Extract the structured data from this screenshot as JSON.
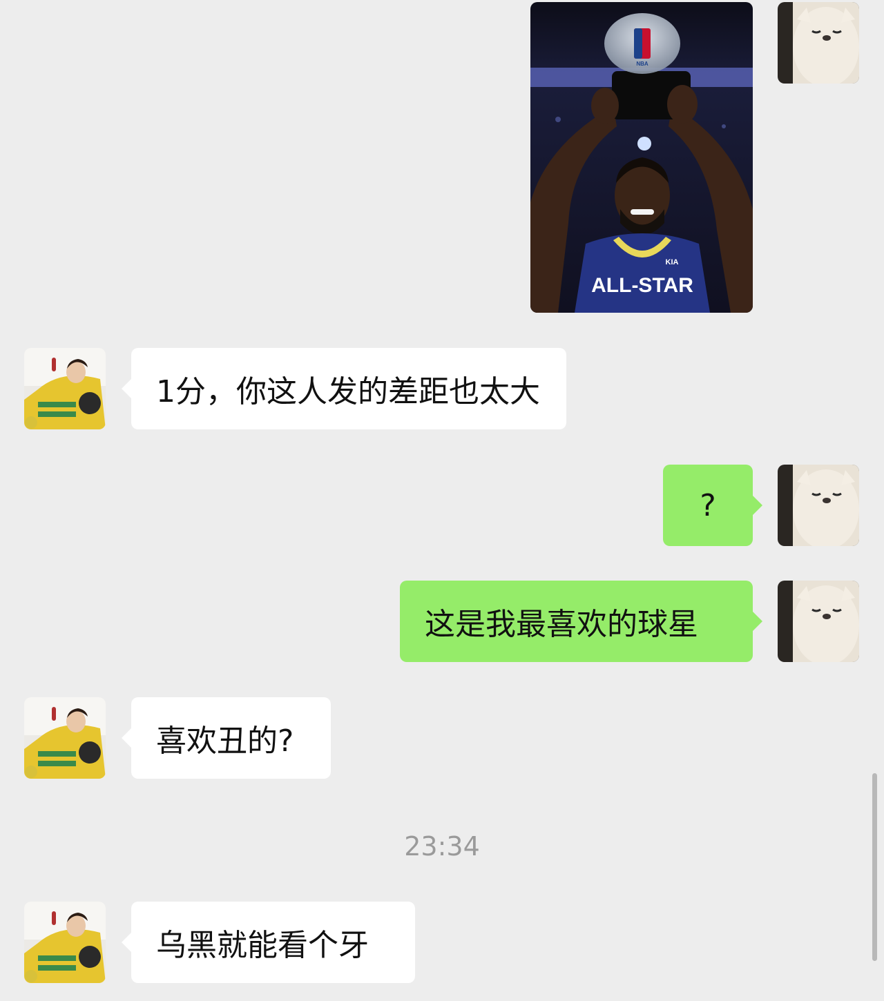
{
  "conversation": {
    "messages": [
      {
        "type": "image",
        "sender": "self",
        "image_content": "basketball-player-holding-trophy"
      },
      {
        "type": "text",
        "sender": "other",
        "text": "1分，你这人发的差距也太大"
      },
      {
        "type": "text",
        "sender": "self",
        "text": "?"
      },
      {
        "type": "text",
        "sender": "self",
        "text": "这是我最喜欢的球星"
      },
      {
        "type": "text",
        "sender": "other",
        "text": "喜欢丑的?"
      },
      {
        "type": "timestamp",
        "text": "23:34"
      },
      {
        "type": "text",
        "sender": "other",
        "text": "乌黑就能看个牙"
      }
    ],
    "photo": {
      "jersey_text": "ALL-STAR",
      "sponsor_text": "KIA",
      "logo_text": "NBA"
    }
  },
  "colors": {
    "background": "#ededed",
    "incoming_bubble": "#ffffff",
    "outgoing_bubble": "#95ec69",
    "timestamp_text": "#9a9a9a"
  },
  "icons": {
    "self_avatar": "white-dog-avatar",
    "other_avatar": "girl-yellow-top-avatar"
  }
}
